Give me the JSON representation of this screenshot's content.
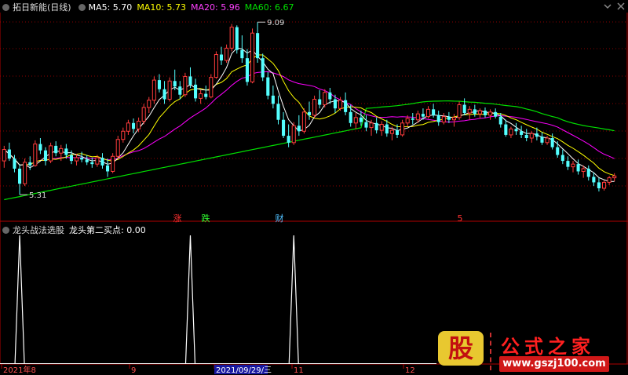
{
  "top_legend": {
    "name": "拓日新能(日线)",
    "ma5": "MA5: 5.70",
    "ma10": "MA10: 5.73",
    "ma20": "MA20: 5.96",
    "ma60": "MA60: 6.67"
  },
  "sub_legend": {
    "name": "龙头战法选股",
    "value": "龙头第二买点: 0.00"
  },
  "colors": {
    "up": "#ff3c3c",
    "down": "#54ffff",
    "ma5": "#ffffff",
    "ma10": "#ffff00",
    "ma20": "#ff00ff",
    "ma60": "#00e000",
    "signal": "#ffffff",
    "grid": "#8b0000",
    "axis": "#b00000"
  },
  "markers": {
    "high": "9.09",
    "low": "5.31",
    "zhang": "涨",
    "die": "跌",
    "cai": "财",
    "five": "5"
  },
  "xaxis_labels": [
    "2021年8",
    "9",
    "2021/09/29/三",
    "11",
    "12"
  ],
  "logo": {
    "gu": "股",
    "title": "公式之家",
    "url": "www.gszj100.com"
  },
  "chart_data": [
    {
      "type": "candlestick",
      "title": "拓日新能(日线)",
      "ylim": [
        4.9,
        9.3
      ],
      "grid": true,
      "ohlc": [
        [
          6.05,
          6.38,
          5.9,
          6.3
        ],
        [
          6.3,
          6.45,
          6.05,
          6.1
        ],
        [
          6.1,
          6.18,
          5.8,
          5.88
        ],
        [
          5.88,
          5.98,
          5.31,
          5.55
        ],
        [
          5.55,
          6.1,
          5.5,
          6.02
        ],
        [
          6.02,
          6.15,
          5.85,
          5.95
        ],
        [
          5.95,
          6.5,
          5.92,
          6.42
        ],
        [
          6.42,
          6.55,
          6.2,
          6.28
        ],
        [
          6.28,
          6.35,
          5.95,
          6.05
        ],
        [
          6.05,
          6.45,
          6.0,
          6.38
        ],
        [
          6.38,
          6.48,
          6.15,
          6.22
        ],
        [
          6.22,
          6.4,
          6.05,
          6.32
        ],
        [
          6.32,
          6.42,
          6.1,
          6.18
        ],
        [
          6.18,
          6.28,
          5.98,
          6.05
        ],
        [
          6.05,
          6.2,
          5.95,
          6.12
        ],
        [
          6.12,
          6.25,
          6.02,
          6.08
        ],
        [
          6.08,
          6.18,
          5.96,
          6.02
        ],
        [
          6.02,
          6.12,
          5.9,
          5.98
        ],
        [
          5.98,
          6.18,
          5.92,
          6.12
        ],
        [
          6.12,
          6.22,
          5.88,
          5.95
        ],
        [
          5.95,
          6.1,
          5.7,
          5.82
        ],
        [
          5.82,
          6.22,
          5.78,
          6.15
        ],
        [
          6.15,
          6.6,
          6.1,
          6.52
        ],
        [
          6.52,
          6.78,
          6.45,
          6.7
        ],
        [
          6.7,
          6.95,
          6.62,
          6.88
        ],
        [
          6.88,
          6.98,
          6.65,
          6.75
        ],
        [
          6.75,
          7.0,
          6.68,
          6.92
        ],
        [
          6.92,
          7.3,
          6.85,
          7.22
        ],
        [
          7.22,
          7.45,
          7.1,
          7.38
        ],
        [
          7.38,
          7.9,
          7.3,
          7.82
        ],
        [
          7.82,
          7.95,
          7.55,
          7.62
        ],
        [
          7.62,
          7.8,
          7.3,
          7.4
        ],
        [
          7.4,
          7.88,
          7.35,
          7.8
        ],
        [
          7.8,
          8.05,
          7.6,
          7.68
        ],
        [
          7.68,
          7.8,
          7.4,
          7.5
        ],
        [
          7.5,
          7.98,
          7.45,
          7.9
        ],
        [
          7.9,
          8.1,
          7.65,
          7.72
        ],
        [
          7.72,
          7.85,
          7.35,
          7.42
        ],
        [
          7.42,
          7.6,
          7.3,
          7.52
        ],
        [
          7.52,
          7.7,
          7.4,
          7.45
        ],
        [
          7.45,
          7.95,
          7.42,
          7.88
        ],
        [
          7.88,
          8.45,
          7.85,
          8.38
        ],
        [
          8.38,
          8.55,
          8.15,
          8.25
        ],
        [
          8.25,
          8.6,
          8.2,
          8.52
        ],
        [
          8.52,
          9.05,
          8.45,
          8.98
        ],
        [
          8.98,
          9.02,
          8.4,
          8.48
        ],
        [
          8.48,
          8.8,
          8.2,
          8.3
        ],
        [
          8.3,
          8.5,
          7.7,
          7.78
        ],
        [
          7.78,
          8.95,
          7.75,
          8.85
        ],
        [
          8.85,
          9.09,
          8.2,
          8.3
        ],
        [
          8.3,
          8.4,
          7.8,
          7.88
        ],
        [
          7.88,
          8.0,
          7.4,
          7.48
        ],
        [
          7.48,
          7.7,
          7.2,
          7.3
        ],
        [
          7.3,
          7.48,
          6.85,
          6.95
        ],
        [
          6.95,
          7.12,
          6.55,
          6.6
        ],
        [
          6.6,
          6.85,
          6.35,
          6.45
        ],
        [
          6.45,
          6.9,
          6.4,
          6.82
        ],
        [
          6.82,
          7.05,
          6.6,
          6.7
        ],
        [
          6.7,
          7.2,
          6.65,
          7.12
        ],
        [
          7.12,
          7.35,
          6.95,
          7.05
        ],
        [
          7.05,
          7.48,
          7.0,
          7.4
        ],
        [
          7.4,
          7.6,
          7.2,
          7.28
        ],
        [
          7.28,
          7.62,
          7.22,
          7.55
        ],
        [
          7.55,
          7.65,
          7.3,
          7.4
        ],
        [
          7.4,
          7.5,
          7.1,
          7.2
        ],
        [
          7.2,
          7.45,
          7.15,
          7.38
        ],
        [
          7.38,
          7.55,
          7.05,
          7.12
        ],
        [
          7.12,
          7.28,
          6.8,
          6.88
        ],
        [
          6.88,
          7.1,
          6.75,
          7.0
        ],
        [
          7.0,
          7.15,
          6.82,
          6.9
        ],
        [
          6.9,
          7.05,
          6.7,
          6.78
        ],
        [
          6.78,
          6.95,
          6.6,
          6.88
        ],
        [
          6.88,
          7.0,
          6.65,
          6.72
        ],
        [
          6.72,
          6.92,
          6.6,
          6.85
        ],
        [
          6.85,
          6.95,
          6.58,
          6.65
        ],
        [
          6.65,
          6.8,
          6.5,
          6.72
        ],
        [
          6.72,
          6.85,
          6.55,
          6.62
        ],
        [
          6.62,
          6.95,
          6.58,
          6.88
        ],
        [
          6.88,
          7.05,
          6.8,
          6.98
        ],
        [
          6.98,
          7.1,
          6.85,
          6.95
        ],
        [
          6.95,
          7.15,
          6.88,
          7.08
        ],
        [
          7.08,
          7.2,
          6.95,
          7.02
        ],
        [
          7.02,
          7.25,
          6.98,
          7.18
        ],
        [
          7.18,
          7.3,
          7.0,
          7.05
        ],
        [
          7.05,
          7.15,
          6.82,
          6.9
        ],
        [
          6.9,
          7.1,
          6.85,
          7.02
        ],
        [
          7.02,
          7.12,
          6.88,
          6.95
        ],
        [
          6.95,
          7.08,
          6.8,
          7.0
        ],
        [
          7.0,
          7.35,
          6.95,
          7.28
        ],
        [
          7.28,
          7.42,
          7.05,
          7.1
        ],
        [
          7.1,
          7.25,
          6.95,
          7.18
        ],
        [
          7.18,
          7.28,
          7.02,
          7.08
        ],
        [
          7.08,
          7.2,
          6.98,
          7.15
        ],
        [
          7.15,
          7.22,
          7.0,
          7.05
        ],
        [
          7.05,
          7.18,
          6.95,
          7.12
        ],
        [
          7.12,
          7.2,
          6.98,
          7.02
        ],
        [
          7.02,
          7.1,
          6.78,
          6.85
        ],
        [
          6.85,
          6.95,
          6.58,
          6.62
        ],
        [
          6.62,
          6.8,
          6.55,
          6.75
        ],
        [
          6.75,
          6.88,
          6.62,
          6.7
        ],
        [
          6.7,
          6.82,
          6.55,
          6.62
        ],
        [
          6.62,
          6.75,
          6.48,
          6.55
        ],
        [
          6.55,
          6.7,
          6.45,
          6.65
        ],
        [
          6.65,
          6.78,
          6.5,
          6.58
        ],
        [
          6.58,
          6.68,
          6.4,
          6.45
        ],
        [
          6.45,
          6.6,
          6.4,
          6.55
        ],
        [
          6.55,
          6.65,
          6.3,
          6.35
        ],
        [
          6.35,
          6.48,
          6.12,
          6.18
        ],
        [
          6.18,
          6.3,
          5.98,
          6.05
        ],
        [
          6.05,
          6.15,
          5.85,
          5.92
        ],
        [
          5.92,
          6.05,
          5.8,
          5.98
        ],
        [
          5.98,
          6.08,
          5.75,
          5.82
        ],
        [
          5.82,
          5.95,
          5.68,
          5.88
        ],
        [
          5.88,
          5.95,
          5.62,
          5.7
        ],
        [
          5.7,
          5.8,
          5.5,
          5.58
        ],
        [
          5.58,
          5.68,
          5.38,
          5.45
        ],
        [
          5.45,
          5.62,
          5.4,
          5.58
        ],
        [
          5.58,
          5.72,
          5.52,
          5.68
        ],
        [
          5.68,
          5.78,
          5.6,
          5.72
        ]
      ],
      "ma_series": [
        {
          "name": "MA5",
          "last": 5.7
        },
        {
          "name": "MA10",
          "last": 5.73
        },
        {
          "name": "MA20",
          "last": 5.96
        },
        {
          "name": "MA60",
          "last": 6.67
        }
      ]
    },
    {
      "type": "line",
      "title": "龙头第二买点",
      "ylim": [
        0,
        1
      ],
      "spikes_at_index": [
        3,
        36,
        56
      ],
      "values_note_last": 0.0
    }
  ]
}
